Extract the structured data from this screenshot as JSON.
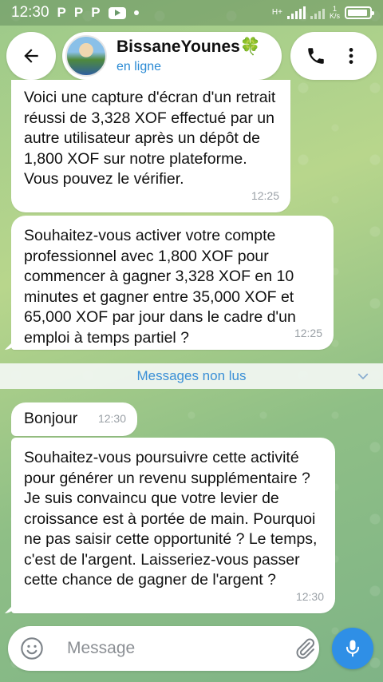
{
  "status_bar": {
    "time": "12:30",
    "notif_icons": [
      "P",
      "P",
      "P"
    ],
    "network_label": "H+",
    "speed_value": "1",
    "speed_unit": "K/s"
  },
  "header": {
    "contact_name": "BissaneYounes",
    "contact_emoji": "🍀",
    "contact_status": "en ligne"
  },
  "messages": [
    {
      "text": "Voici une capture d'écran d'un retrait réussi de 3,328 XOF effectué par un autre utilisateur après un dépôt de 1,800 XOF sur notre plateforme. Vous pouvez le vérifier.",
      "time": "12:25"
    },
    {
      "text": "Souhaitez-vous activer votre compte professionnel avec 1,800 XOF pour commencer à gagner 3,328 XOF en 10 minutes et gagner entre 35,000 XOF et 65,000 XOF par jour dans le cadre d'un emploi à temps partiel ?",
      "time": "12:25"
    },
    {
      "text": "Bonjour",
      "time": "12:30"
    },
    {
      "text": "Souhaitez-vous poursuivre cette activité pour générer un revenu supplémentaire ? Je suis convaincu que votre levier de croissance est à portée de main. Pourquoi ne pas saisir cette opportunité ? Le temps, c'est de l'argent. Laisseriez-vous passer cette chance de gagner de l'argent ?",
      "time": "12:30"
    }
  ],
  "unread_label": "Messages non lus",
  "composer": {
    "placeholder": "Message"
  },
  "colors": {
    "accent": "#2f8fe6",
    "link": "#3a8fd6",
    "bubble": "#ffffff"
  }
}
